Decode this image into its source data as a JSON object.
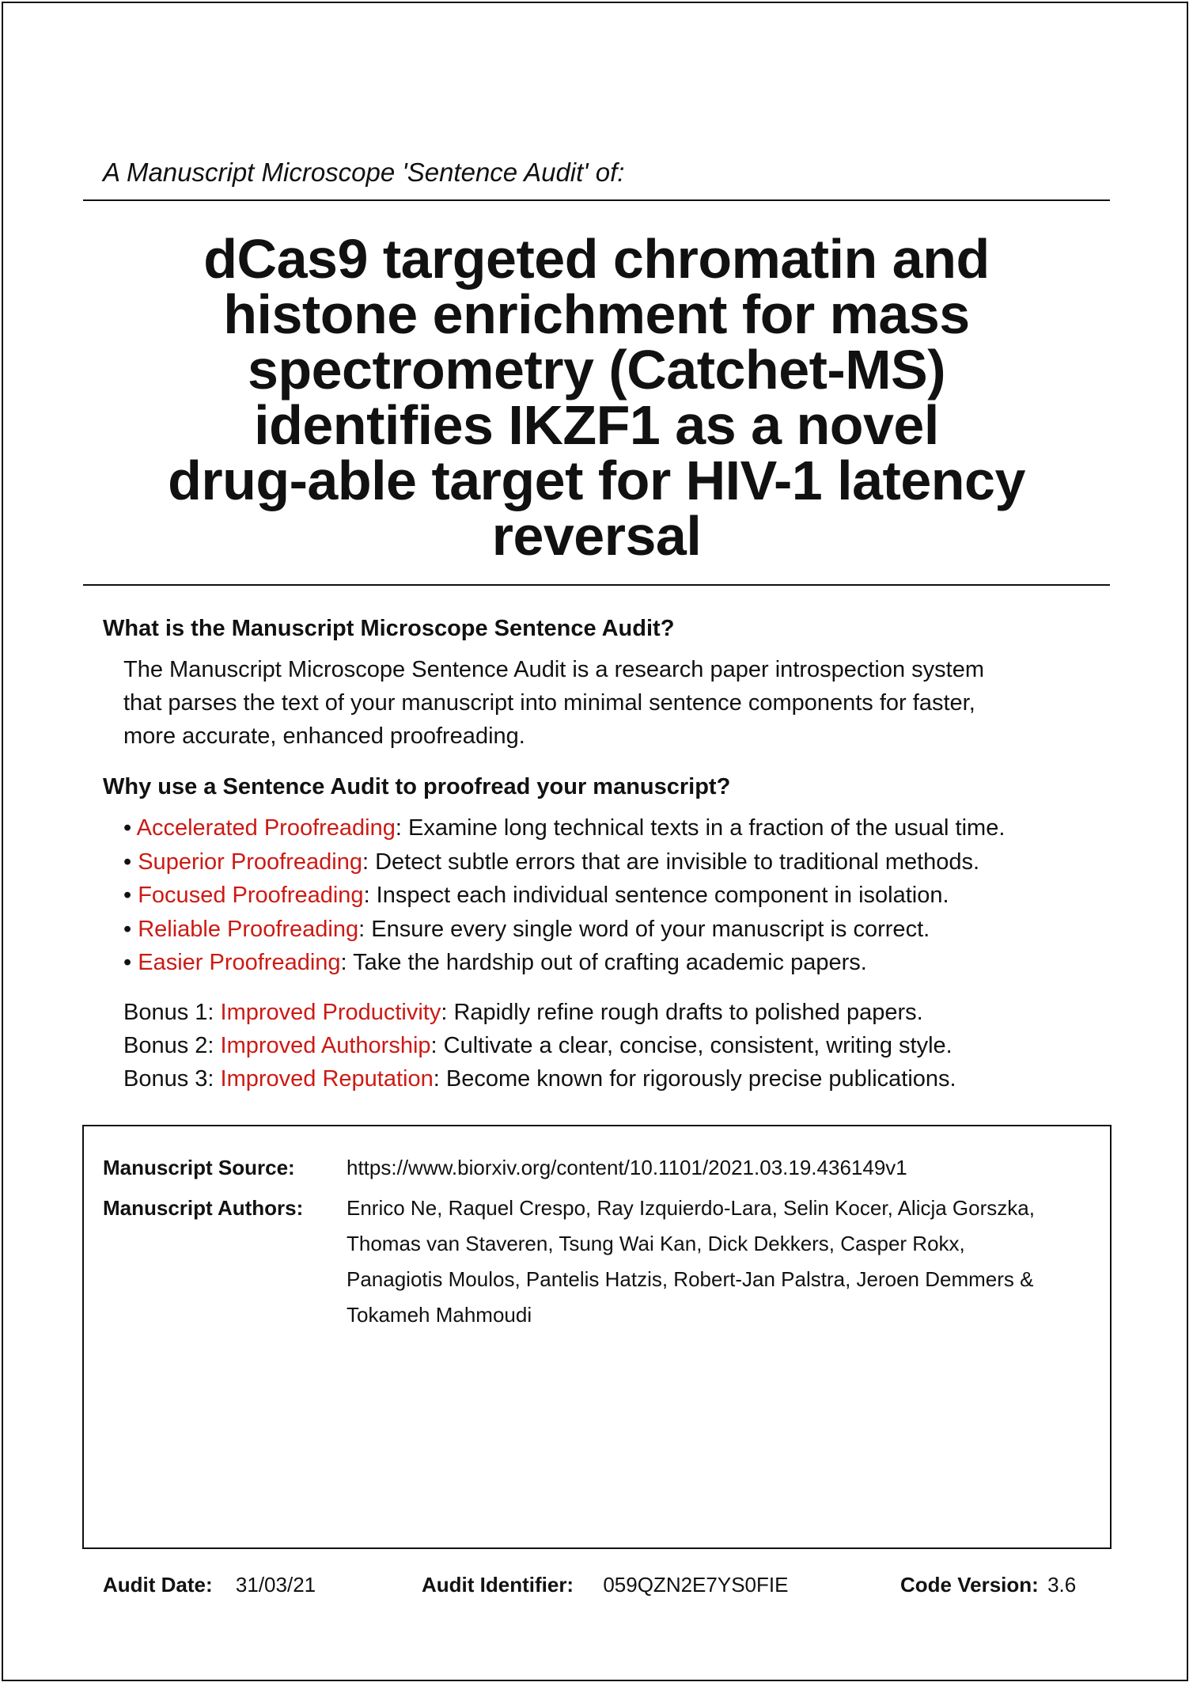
{
  "header": {
    "intro": "A Manuscript Microscope 'Sentence Audit' of:"
  },
  "title_lines": [
    "dCas9 targeted chromatin and",
    "histone enrichment for mass",
    "spectrometry (Catchet-MS)",
    "identifies IKZF1 as a novel",
    "drug-able target for HIV-1 latency",
    "reversal"
  ],
  "what": {
    "heading": "What is the Manuscript Microscope Sentence Audit?",
    "lines": [
      "The Manuscript Microscope Sentence Audit is a research paper introspection system",
      "that parses the text of your manuscript into minimal sentence components for faster,",
      "more accurate, enhanced proofreading."
    ]
  },
  "why": {
    "heading": "Why use a Sentence Audit to proofread your manuscript?",
    "bullet_char": "•",
    "bullets": [
      {
        "term": "Accelerated Proofreading",
        "desc": ": Examine long technical texts in a fraction of the usual time."
      },
      {
        "term": "Superior Proofreading",
        "desc": ": Detect subtle errors that are invisible to traditional methods."
      },
      {
        "term": "Focused Proofreading",
        "desc": ": Inspect each individual sentence component in isolation."
      },
      {
        "term": "Reliable Proofreading",
        "desc": ": Ensure every single word of your manuscript is correct."
      },
      {
        "term": "Easier Proofreading",
        "desc": ": Take the hardship out of crafting academic papers."
      }
    ],
    "bonuses": [
      {
        "prefix": "Bonus 1: ",
        "term": "Improved Productivity",
        "desc": ": Rapidly refine rough drafts to polished papers."
      },
      {
        "prefix": "Bonus 2: ",
        "term": "Improved Authorship",
        "desc": ": Cultivate a clear, concise, consistent, writing style."
      },
      {
        "prefix": "Bonus 3: ",
        "term": "Improved Reputation",
        "desc": ": Become known for rigorously precise publications."
      }
    ]
  },
  "manuscript": {
    "source_label": "Manuscript Source:",
    "source": "https://www.biorxiv.org/content/10.1101/2021.03.19.436149v1",
    "authors_label": "Manuscript Authors:",
    "authors_lines": [
      "Enrico Ne, Raquel Crespo, Ray Izquierdo-Lara, Selin Kocer, Alicja Gorszka,",
      "Thomas van Staveren, Tsung Wai Kan, Dick Dekkers, Casper Rokx,",
      "Panagiotis Moulos, Pantelis Hatzis, Robert-Jan Palstra, Jeroen Demmers &",
      "Tokameh Mahmoudi"
    ]
  },
  "footer": {
    "audit_date_label": "Audit Date:",
    "audit_date": "31/03/21",
    "audit_id_label": "Audit Identifier:",
    "audit_id": "059QZN2E7YS0FIE",
    "code_version_label": "Code Version:",
    "code_version": "3.6"
  },
  "colors": {
    "highlight": "#cc1a14",
    "text": "#111111"
  }
}
